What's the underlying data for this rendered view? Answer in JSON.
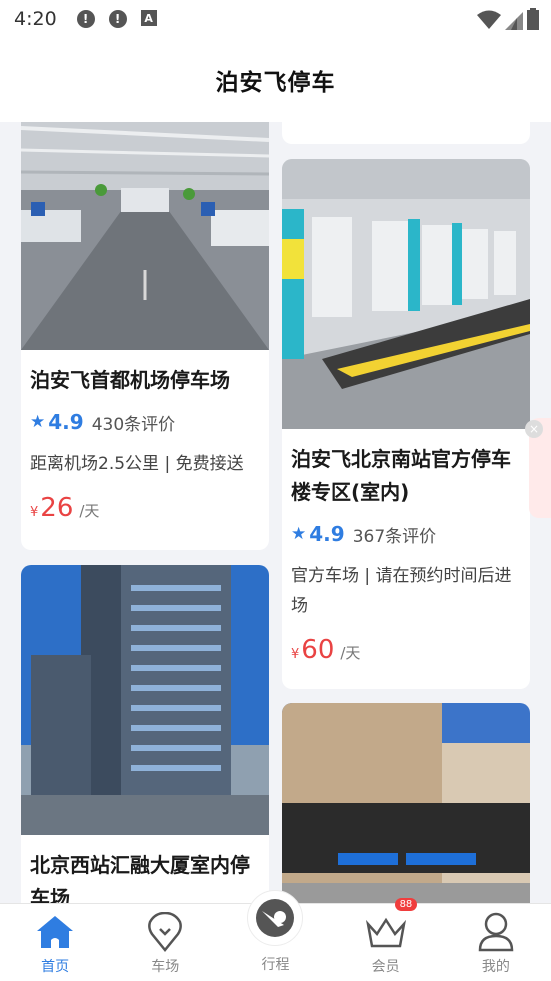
{
  "status_bar": {
    "time": "4:20",
    "notif_icons": [
      "alert-icon",
      "alert-icon",
      "text-icon"
    ],
    "sys_icons": [
      "wifi-icon",
      "signal-icon",
      "battery-icon"
    ]
  },
  "header": {
    "title": "泊安飞停车"
  },
  "parking_lots": [
    {
      "name": "泊安飞首都机场停车场",
      "rating": "4.9",
      "reviews": "430条评价",
      "desc": "距离机场2.5公里 | 免费接送",
      "currency": "¥",
      "price": "26",
      "unit": "/天"
    },
    {
      "name": "泊安飞北京南站官方停车楼专区(室内)",
      "rating": "4.9",
      "reviews": "367条评价",
      "desc": "官方车场 | 请在预约时间后进场",
      "currency": "¥",
      "price": "60",
      "unit": "/天"
    },
    {
      "name": "北京西站汇融大厦室内停车场"
    }
  ],
  "tabs": [
    {
      "label": "首页",
      "icon": "home-icon",
      "active": true
    },
    {
      "label": "车场",
      "icon": "location-pin-icon"
    },
    {
      "label": "行程",
      "icon": "trip-logo-icon"
    },
    {
      "label": "会员",
      "icon": "crown-icon",
      "badge": "88"
    },
    {
      "label": "我的",
      "icon": "user-icon"
    }
  ],
  "colors": {
    "accent": "#2f7de1",
    "price": "#e94343"
  }
}
